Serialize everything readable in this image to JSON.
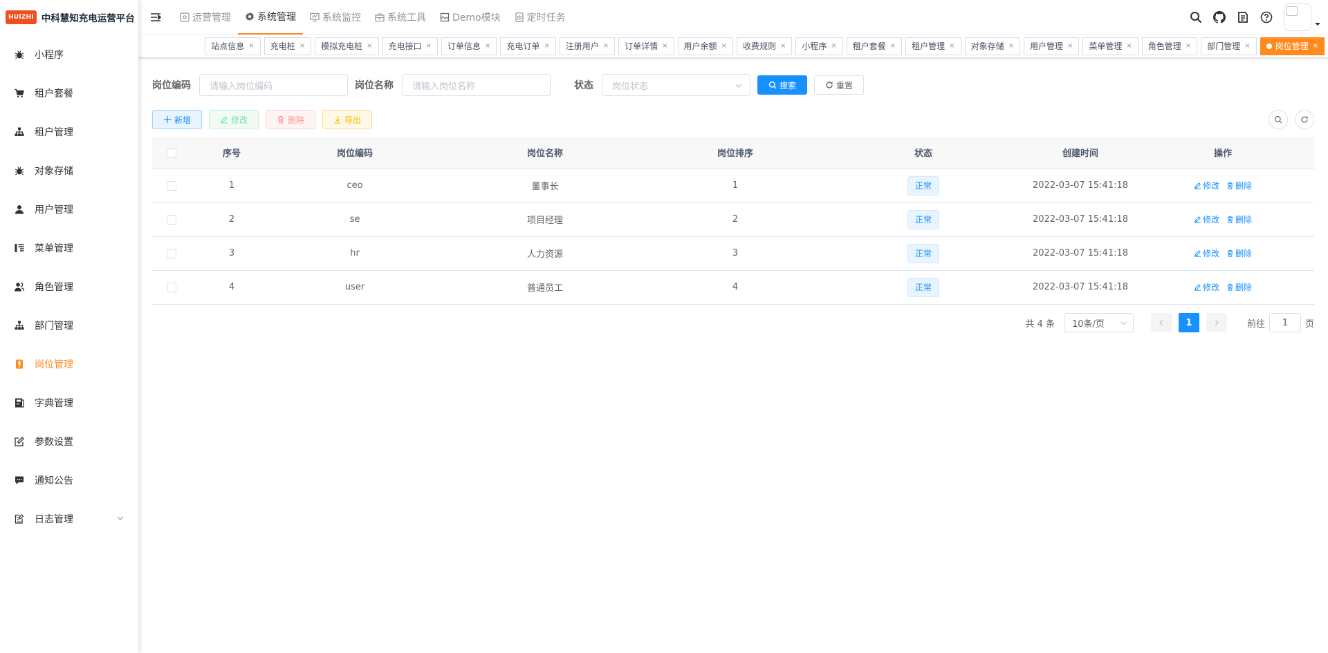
{
  "logo": {
    "badge": "HUIZHI",
    "title": "中科慧知充电运营平台"
  },
  "sidebar": {
    "items": [
      {
        "label": "小程序",
        "icon": "bug-icon"
      },
      {
        "label": "租户套餐",
        "icon": "cart-icon"
      },
      {
        "label": "租户管理",
        "icon": "tree-icon"
      },
      {
        "label": "对象存储",
        "icon": "bug-icon"
      },
      {
        "label": "用户管理",
        "icon": "user-icon"
      },
      {
        "label": "菜单管理",
        "icon": "tree-table-icon"
      },
      {
        "label": "角色管理",
        "icon": "peoples-icon"
      },
      {
        "label": "部门管理",
        "icon": "tree-icon"
      },
      {
        "label": "岗位管理",
        "icon": "post-icon",
        "active": true
      },
      {
        "label": "字典管理",
        "icon": "dict-icon"
      },
      {
        "label": "参数设置",
        "icon": "edit-icon"
      },
      {
        "label": "通知公告",
        "icon": "message-icon"
      },
      {
        "label": "日志管理",
        "icon": "log-icon",
        "has_children": true
      }
    ]
  },
  "topmenu": {
    "items": [
      {
        "label": "运营管理",
        "icon": "cog-icon"
      },
      {
        "label": "系统管理",
        "icon": "gear-icon",
        "active": true
      },
      {
        "label": "系统监控",
        "icon": "monitor-icon"
      },
      {
        "label": "系统工具",
        "icon": "tool-icon"
      },
      {
        "label": "Demo模块",
        "icon": "demo-icon"
      },
      {
        "label": "定时任务",
        "icon": "job-icon"
      }
    ]
  },
  "tags": [
    "站点信息",
    "充电桩",
    "模拟充电桩",
    "充电接口",
    "订单信息",
    "充电订单",
    "注册用户",
    "订单详情",
    "用户余额",
    "收费规则",
    "小程序",
    "租户套餐",
    "租户管理",
    "对象存储",
    "用户管理",
    "菜单管理",
    "角色管理",
    "部门管理",
    "岗位管理"
  ],
  "tags_active": "岗位管理",
  "search": {
    "post_code_label": "岗位编码",
    "post_code_placeholder": "请输入岗位编码",
    "post_name_label": "岗位名称",
    "post_name_placeholder": "请输入岗位名称",
    "status_label": "状态",
    "status_placeholder": "岗位状态",
    "search_button": "搜索",
    "reset_button": "重置"
  },
  "toolbar": {
    "add": "新增",
    "edit": "修改",
    "delete": "删除",
    "export": "导出"
  },
  "table": {
    "headers": [
      "序号",
      "岗位编码",
      "岗位名称",
      "岗位排序",
      "状态",
      "创建时间",
      "操作"
    ],
    "rows": [
      {
        "id": "1",
        "code": "ceo",
        "name": "董事长",
        "sort": "1",
        "status": "正常",
        "created": "2022-03-07 15:41:18"
      },
      {
        "id": "2",
        "code": "se",
        "name": "项目经理",
        "sort": "2",
        "status": "正常",
        "created": "2022-03-07 15:41:18"
      },
      {
        "id": "3",
        "code": "hr",
        "name": "人力资源",
        "sort": "3",
        "status": "正常",
        "created": "2022-03-07 15:41:18"
      },
      {
        "id": "4",
        "code": "user",
        "name": "普通员工",
        "sort": "4",
        "status": "正常",
        "created": "2022-03-07 15:41:18"
      }
    ],
    "op_edit": "修改",
    "op_delete": "删除"
  },
  "pagination": {
    "total": "共 4 条",
    "page_size": "10条/页",
    "current": "1",
    "goto_prefix": "前往",
    "goto_value": "1",
    "goto_suffix": "页"
  },
  "colors": {
    "accent": "#ff8a1e",
    "primary": "#1890ff",
    "logo": "#f04e1f"
  }
}
